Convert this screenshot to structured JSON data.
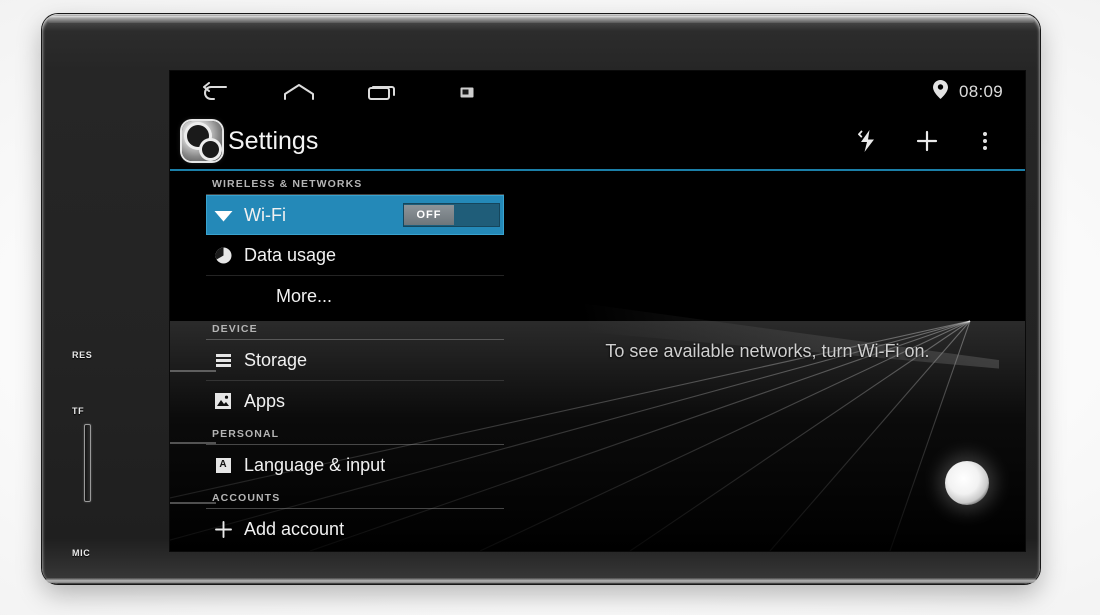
{
  "device": {
    "bezel_labels": [
      {
        "name": "reset",
        "text": "RES"
      },
      {
        "name": "tf-card",
        "text": "TF"
      },
      {
        "name": "microphone",
        "text": "MIC"
      }
    ]
  },
  "statusbar": {
    "nav": [
      {
        "name": "back",
        "icon": "back-arrow-icon"
      },
      {
        "name": "home",
        "icon": "home-icon"
      },
      {
        "name": "recents",
        "icon": "recents-icon"
      },
      {
        "name": "screenshot",
        "icon": "screenshot-icon"
      }
    ],
    "location_icon": "location-pin-icon",
    "time": "08:09"
  },
  "actionbar": {
    "app_icon": "settings-app-icon",
    "title": "Settings",
    "actions": [
      {
        "name": "sync",
        "icon": "sync-icon"
      },
      {
        "name": "add",
        "icon": "plus-icon"
      },
      {
        "name": "overflow",
        "icon": "overflow-menu-icon"
      }
    ]
  },
  "settings": {
    "sections": [
      {
        "header": "WIRELESS & NETWORKS",
        "rows": [
          {
            "label": "Wi-Fi",
            "icon": "wifi-icon",
            "selected": true,
            "toggle": "OFF"
          },
          {
            "label": "Data usage",
            "icon": "data-usage-icon"
          },
          {
            "label": "More...",
            "icon": "",
            "indent": true
          }
        ]
      },
      {
        "header": "DEVICE",
        "rows": [
          {
            "label": "Storage",
            "icon": "storage-icon"
          },
          {
            "label": "Apps",
            "icon": "apps-icon"
          }
        ]
      },
      {
        "header": "PERSONAL",
        "rows": [
          {
            "label": "Language & input",
            "icon": "language-input-icon"
          }
        ]
      },
      {
        "header": "ACCOUNTS",
        "rows": [
          {
            "label": "Add account",
            "icon": "plus-icon"
          }
        ]
      }
    ]
  },
  "content": {
    "empty_message": "To see available networks, turn Wi-Fi on."
  },
  "colors": {
    "accent_blue": "#2489b8",
    "divider_blue": "#1b7fa8",
    "screen_black": "#000000",
    "text_primary": "#f1f1f1",
    "text_secondary": "#b5b5b5"
  }
}
